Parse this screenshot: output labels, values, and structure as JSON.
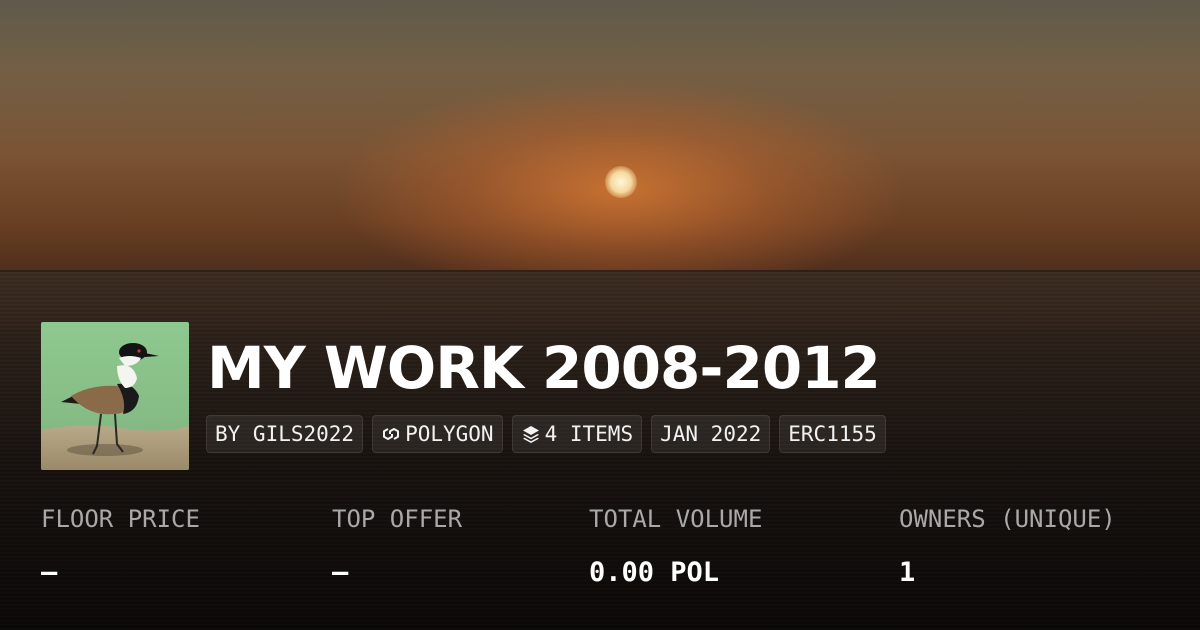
{
  "collection": {
    "title": "MY WORK 2008-2012",
    "avatar_icon": "lapwing-bird-photo"
  },
  "badges": [
    {
      "label": "BY GILS2022"
    },
    {
      "label": "POLYGON",
      "icon": "polygon-chain-icon"
    },
    {
      "label": "4 ITEMS",
      "icon": "layers-icon"
    },
    {
      "label": "JAN 2022"
    },
    {
      "label": "ERC1155"
    }
  ],
  "stats": [
    {
      "label": "FLOOR PRICE",
      "value": "–"
    },
    {
      "label": "TOP OFFER",
      "value": "–"
    },
    {
      "label": "TOTAL VOLUME",
      "value": "0.00 POL"
    },
    {
      "label": "OWNERS (UNIQUE)",
      "value": "1"
    }
  ],
  "colors": {
    "text": "#ffffff",
    "label": "#a9a9a9",
    "sun": "#f5d9a0"
  }
}
